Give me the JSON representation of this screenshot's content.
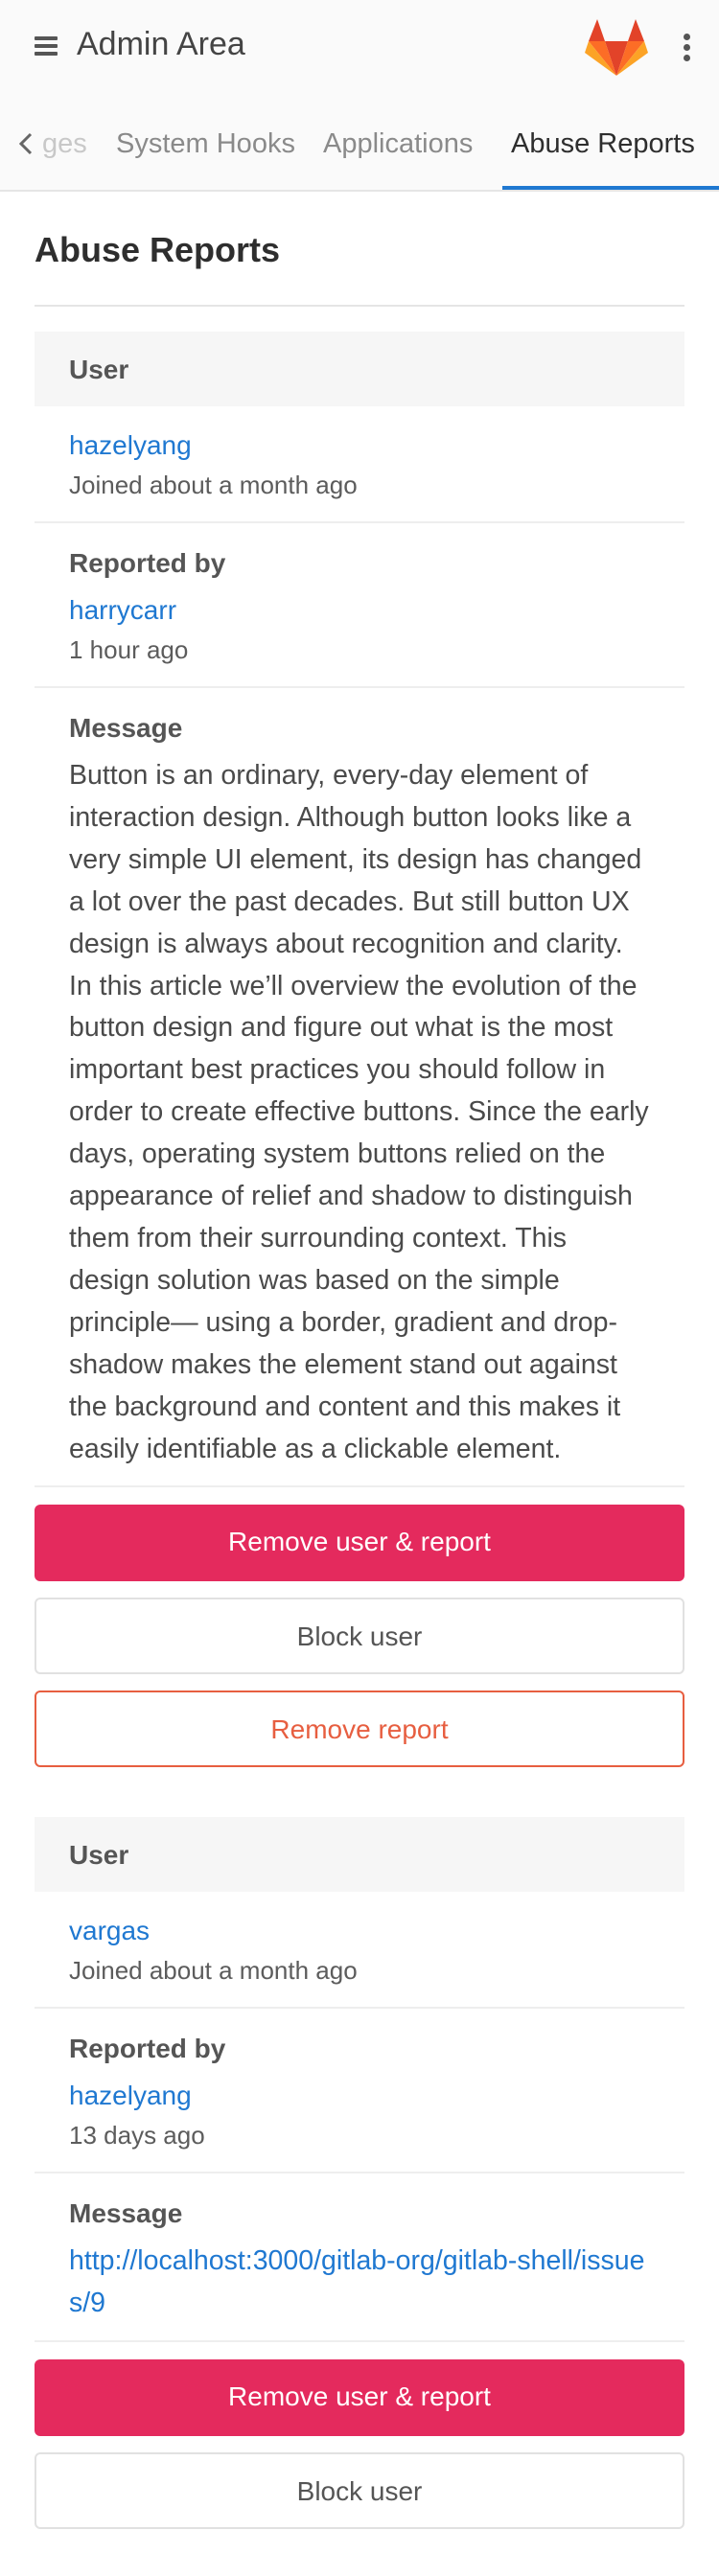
{
  "header": {
    "title": "Admin Area",
    "menu_icon": "hamburger-menu-icon",
    "logo": "gitlab-tanuki-logo",
    "more_icon": "vertical-ellipsis-icon"
  },
  "tabs": [
    {
      "label": "ges",
      "active": false
    },
    {
      "label": "System Hooks",
      "active": false
    },
    {
      "label": "Applications",
      "active": false
    },
    {
      "label": "Abuse Reports",
      "active": true
    }
  ],
  "page": {
    "title": "Abuse Reports"
  },
  "labels": {
    "user": "User",
    "reported_by": "Reported by",
    "message": "Message",
    "remove_user_report": "Remove user & report",
    "block_user": "Block user",
    "remove_report": "Remove report"
  },
  "reports": [
    {
      "user": "hazelyang",
      "user_joined": "Joined about a month ago",
      "reporter": "harrycarr",
      "reported_time": "1 hour ago",
      "message": "Button is an ordinary, every-day element of interaction design. Although button looks like a very simple UI element, its design has changed a lot over the past decades. But still button UX design is always about recognition and clarity. In this article we’ll overview the evolution of the button design and figure out what is the most important best practices you should follow in order to create effective buttons. Since the early days, operating system buttons relied on the appearance of relief and shadow to distinguish them from their surrounding context. This design solution was based on the simple principle— using a border, gradient and drop-shadow makes the element stand out against the background and content and this makes it easily identifiable as a clickable element."
    },
    {
      "user": "vargas",
      "user_joined": "Joined about a month ago",
      "reporter": "hazelyang",
      "reported_time": "13 days ago",
      "message": "http://localhost:3000/gitlab-org/gitlab-shell/issues/9"
    }
  ],
  "colors": {
    "link": "#1f78d1",
    "danger": "#e42a5d",
    "remove_report": "#e75e40",
    "active_tab": "#1f78d1"
  }
}
